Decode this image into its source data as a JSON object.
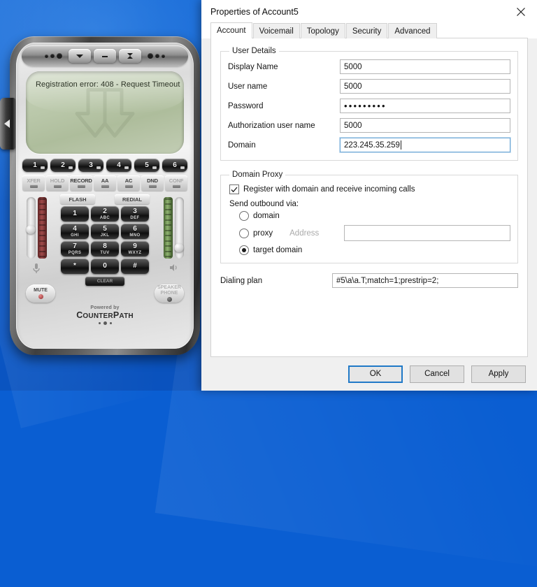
{
  "desktop": {
    "background_color": "#0a5ed2"
  },
  "softphone": {
    "app_name": "CounterPath Softphone",
    "lcd_message": "Registration error: 408 - Request Timeout",
    "titlebar_buttons": [
      {
        "name": "menu-dropdown-button",
        "glyph": "▼"
      },
      {
        "name": "minimize-button",
        "glyph": "–"
      },
      {
        "name": "close-button",
        "glyph": "✕"
      }
    ],
    "line_buttons": [
      "1",
      "2",
      "3",
      "4",
      "5",
      "6"
    ],
    "function_buttons": [
      {
        "label": "XFER",
        "enabled": false
      },
      {
        "label": "HOLD",
        "enabled": false
      },
      {
        "label": "RECORD",
        "enabled": true
      },
      {
        "label": "AA",
        "enabled": true
      },
      {
        "label": "AC",
        "enabled": true
      },
      {
        "label": "DND",
        "enabled": true
      },
      {
        "label": "CONF",
        "enabled": false
      }
    ],
    "flash_label": "FLASH",
    "redial_label": "REDIAL",
    "keypad": [
      {
        "num": "1",
        "letters": ""
      },
      {
        "num": "2",
        "letters": "ABC"
      },
      {
        "num": "3",
        "letters": "DEF"
      },
      {
        "num": "4",
        "letters": "GHI"
      },
      {
        "num": "5",
        "letters": "JKL"
      },
      {
        "num": "6",
        "letters": "MNO"
      },
      {
        "num": "7",
        "letters": "PQRS"
      },
      {
        "num": "8",
        "letters": "TUV"
      },
      {
        "num": "9",
        "letters": "WXYZ"
      },
      {
        "num": "*",
        "letters": ""
      },
      {
        "num": "0",
        "letters": ""
      },
      {
        "num": "#",
        "letters": ""
      }
    ],
    "clear_label": "CLEAR",
    "mute_label": "MUTE",
    "speaker_label_line1": "SPEAKER",
    "speaker_label_line2": "PHONE",
    "brand_powered_by": "Powered by",
    "brand_name_part1": "C",
    "brand_name_part2": "OUNTER",
    "brand_name_part3": "P",
    "brand_name_part4": "ATH",
    "mic_icon": "microphone-icon",
    "speaker_icon": "speaker-icon"
  },
  "dialog": {
    "title": "Properties of Account5",
    "close_icon": "close-icon",
    "tabs": [
      {
        "label": "Account",
        "active": true
      },
      {
        "label": "Voicemail",
        "active": false
      },
      {
        "label": "Topology",
        "active": false
      },
      {
        "label": "Security",
        "active": false
      },
      {
        "label": "Advanced",
        "active": false
      }
    ],
    "user_details": {
      "legend": "User Details",
      "fields": [
        {
          "label": "Display Name",
          "value": "5000",
          "type": "text",
          "focused": false
        },
        {
          "label": "User name",
          "value": "5000",
          "type": "text",
          "focused": false
        },
        {
          "label": "Password",
          "value": "•••••••••",
          "type": "password",
          "focused": false
        },
        {
          "label": "Authorization user name",
          "value": "5000",
          "type": "text",
          "focused": false
        },
        {
          "label": "Domain",
          "value": "223.245.35.259",
          "type": "text",
          "focused": true
        }
      ]
    },
    "domain_proxy": {
      "legend": "Domain Proxy",
      "register_checkbox": {
        "label": "Register with domain and receive incoming calls",
        "checked": true
      },
      "send_outbound_label": "Send outbound via:",
      "options": [
        {
          "label": "domain",
          "selected": false
        },
        {
          "label": "proxy",
          "selected": false
        },
        {
          "label": "target domain",
          "selected": true
        }
      ],
      "address_label": "Address",
      "address_value": "",
      "address_enabled": false
    },
    "dialing_plan": {
      "label": "Dialing plan",
      "value": "#5\\a\\a.T;match=1;prestrip=2;"
    },
    "buttons": [
      {
        "label": "OK",
        "default": true
      },
      {
        "label": "Cancel",
        "default": false
      },
      {
        "label": "Apply",
        "default": false
      }
    ]
  }
}
